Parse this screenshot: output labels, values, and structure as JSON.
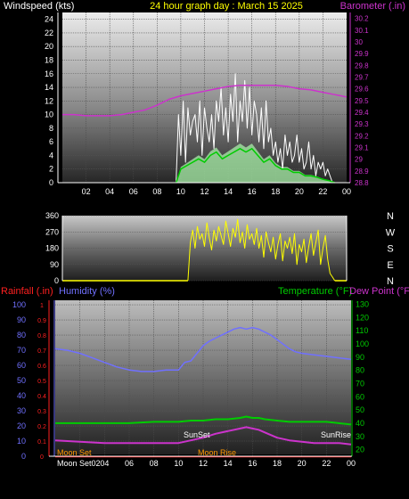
{
  "header": {
    "title": "24 hour graph day : March 15 2025",
    "left_axis_title": "Windspeed (kts)",
    "right_axis_title": "Barometer (.in)"
  },
  "colors": {
    "windspeed": "#ffffff",
    "wind_average": "#00cc00",
    "wind_band": "#a8f0a8",
    "barometer": "#cc33cc",
    "wind_direction": "#ffff00",
    "humidity": "#7070ff",
    "temperature": "#00cc00",
    "dew_point": "#cc33cc",
    "rainfall": "#ff2020",
    "title": "#ffff00",
    "moon": "#ff9900"
  },
  "chart_data": [
    {
      "type": "line",
      "panel": "wind",
      "x_ticks": [
        "02",
        "04",
        "06",
        "08",
        "10",
        "12",
        "14",
        "16",
        "18",
        "20",
        "22",
        "00"
      ],
      "left_ticks": [
        "0",
        "2",
        "4",
        "6",
        "8",
        "10",
        "12",
        "14",
        "16",
        "18",
        "20",
        "22",
        "24"
      ],
      "right_ticks": [
        "28.8",
        "28.9",
        "29",
        "29.1",
        "29.2",
        "29.3",
        "29.4",
        "29.5",
        "29.6",
        "29.7",
        "29.8",
        "29.9",
        "30",
        "30.1",
        "30.2"
      ],
      "ylim_left": [
        0,
        25
      ],
      "ylim_right": [
        28.8,
        30.25
      ],
      "xlim": [
        0,
        24
      ],
      "series": [
        {
          "name": "Windspeed",
          "axis": "left",
          "x": [
            9.6,
            9.8,
            10,
            10.2,
            10.4,
            10.6,
            10.8,
            11,
            11.2,
            11.4,
            11.6,
            11.8,
            12,
            12.2,
            12.4,
            12.6,
            12.8,
            13,
            13.2,
            13.4,
            13.6,
            13.8,
            14,
            14.2,
            14.4,
            14.6,
            14.8,
            15,
            15.2,
            15.4,
            15.6,
            15.8,
            16,
            16.2,
            16.4,
            16.6,
            16.8,
            17,
            17.2,
            17.4,
            17.6,
            17.8,
            18,
            18.2,
            18.4,
            18.6,
            18.8,
            19,
            19.2,
            19.4,
            19.6,
            19.8,
            20,
            20.2,
            20.4,
            20.6,
            20.8,
            21,
            21.2,
            21.4,
            21.6,
            21.8,
            22,
            22.2,
            22.4,
            22.6,
            22.8,
            23
          ],
          "values": [
            0,
            10,
            4,
            12,
            3,
            11,
            7,
            9,
            10,
            6,
            12,
            4,
            11,
            8,
            6,
            10,
            5,
            12,
            9,
            14,
            7,
            11,
            6,
            13,
            9,
            16,
            6,
            12,
            9,
            15,
            8,
            14,
            7,
            12,
            10,
            6,
            11,
            5,
            12,
            6,
            8,
            4,
            6,
            3,
            5,
            2,
            7,
            4,
            6,
            3,
            4,
            7,
            3,
            5,
            2,
            3,
            6,
            2,
            4,
            1,
            3,
            2,
            3,
            1,
            2,
            1,
            0,
            0
          ]
        },
        {
          "name": "Wind average",
          "axis": "left",
          "x": [
            9.6,
            10,
            10.5,
            11,
            11.5,
            12,
            12.5,
            13,
            13.5,
            14,
            14.5,
            15,
            15.5,
            16,
            16.5,
            17,
            17.5,
            18,
            18.5,
            19,
            19.5,
            20,
            20.5,
            21,
            21.5,
            22,
            22.5,
            23
          ],
          "values": [
            0,
            2,
            2.5,
            3,
            3.5,
            3,
            4,
            4.5,
            3.5,
            4,
            4.5,
            5,
            4.5,
            5,
            4,
            3,
            3.5,
            2.5,
            2,
            2,
            1.5,
            1.5,
            1,
            1,
            0.8,
            0.5,
            0.3,
            0
          ]
        },
        {
          "name": "Barometer",
          "axis": "right",
          "x": [
            0,
            1,
            2,
            3,
            4,
            5,
            6,
            7,
            8,
            9,
            10,
            11,
            12,
            13,
            14,
            15,
            16,
            17,
            18,
            19,
            20,
            21,
            22,
            23,
            24
          ],
          "values": [
            29.38,
            29.38,
            29.37,
            29.37,
            29.37,
            29.38,
            29.4,
            29.42,
            29.46,
            29.51,
            29.54,
            29.56,
            29.58,
            29.6,
            29.62,
            29.63,
            29.63,
            29.63,
            29.63,
            29.62,
            29.6,
            29.59,
            29.57,
            29.55,
            29.53
          ]
        }
      ]
    },
    {
      "type": "line",
      "panel": "direction",
      "left_ticks": [
        "0",
        "90",
        "180",
        "270",
        "360"
      ],
      "right_ticks": [
        "N",
        "E",
        "S",
        "W",
        "N"
      ],
      "ylim": [
        0,
        360
      ],
      "xlim": [
        0,
        24
      ],
      "series": [
        {
          "name": "Wind direction",
          "x": [
            10.6,
            10.8,
            11,
            11.2,
            11.4,
            11.6,
            11.8,
            12,
            12.2,
            12.4,
            12.6,
            12.8,
            13,
            13.2,
            13.4,
            13.6,
            13.8,
            14,
            14.2,
            14.4,
            14.6,
            14.8,
            15,
            15.2,
            15.4,
            15.6,
            15.8,
            16,
            16.2,
            16.4,
            16.6,
            16.8,
            17,
            17.2,
            17.4,
            17.6,
            17.8,
            18,
            18.2,
            18.4,
            18.6,
            18.8,
            19,
            19.2,
            19.4,
            19.6,
            19.8,
            20,
            20.2,
            20.4,
            20.6,
            20.8,
            21,
            21.2,
            21.4,
            21.6,
            21.8,
            22,
            22.2,
            22.4,
            22.6,
            22.8,
            23
          ],
          "values": [
            0,
            210,
            280,
            180,
            300,
            230,
            260,
            190,
            320,
            240,
            170,
            280,
            220,
            300,
            250,
            200,
            330,
            260,
            190,
            290,
            240,
            340,
            210,
            270,
            180,
            310,
            230,
            260,
            200,
            290,
            180,
            250,
            130,
            270,
            210,
            160,
            240,
            120,
            200,
            260,
            110,
            220,
            180,
            240,
            150,
            260,
            90,
            200,
            160,
            230,
            100,
            190,
            260,
            140,
            210,
            280,
            90,
            180,
            250,
            120,
            40,
            20,
            0
          ]
        }
      ]
    },
    {
      "type": "line",
      "panel": "climate",
      "x_ticks": [
        "02",
        "04",
        "06",
        "08",
        "10",
        "12",
        "14",
        "16",
        "18",
        "20",
        "22",
        "00"
      ],
      "rain_ticks": [
        "0",
        "0.1",
        "0.2",
        "0.3",
        "0.4",
        "0.5",
        "0.6",
        "0.7",
        "0.8",
        "0.9",
        "1"
      ],
      "humidity_ticks": [
        "0",
        "10",
        "20",
        "30",
        "40",
        "50",
        "60",
        "70",
        "80",
        "90",
        "100"
      ],
      "temp_ticks": [
        "20",
        "30",
        "40",
        "50",
        "60",
        "70",
        "80",
        "90",
        "100",
        "110",
        "120",
        "130"
      ],
      "ylim_humidity": [
        0,
        100
      ],
      "ylim_temp": [
        15,
        130
      ],
      "xlim": [
        0,
        24
      ],
      "labels": {
        "rainfall": "Rainfall (.in)",
        "humidity": "Humidity (%)",
        "temperature": "Temperature (°F)",
        "dew_point": "Dew Point (°F)"
      },
      "annotations": {
        "sunset": "SunSet",
        "sunrise": "SunRise",
        "moon_set": "Moon Set",
        "moon_set_axis": "Moon Set02",
        "moon_rise": "Moon Rise"
      },
      "series": [
        {
          "name": "Humidity",
          "x": [
            0,
            1,
            2,
            3,
            4,
            5,
            6,
            7,
            8,
            9,
            10,
            10.5,
            11,
            11.5,
            12,
            12.5,
            13,
            13.5,
            14,
            14.5,
            15,
            15.5,
            16,
            16.5,
            17,
            17.5,
            18,
            18.5,
            19,
            19.5,
            20,
            21,
            22,
            23,
            24
          ],
          "values": [
            71,
            70,
            68,
            65,
            62,
            59,
            57,
            56,
            56,
            57,
            57,
            62,
            63,
            68,
            73,
            76,
            78,
            80,
            82,
            84,
            85,
            84,
            85,
            84,
            82,
            80,
            77,
            74,
            71,
            69,
            68,
            67,
            66,
            65,
            64
          ]
        },
        {
          "name": "Temperature",
          "x": [
            0,
            2,
            4,
            6,
            8,
            10,
            11,
            12,
            13,
            14,
            15,
            15.5,
            16,
            16.5,
            17,
            18,
            19,
            20,
            21,
            22,
            23,
            24
          ],
          "values": [
            40,
            40,
            40,
            40,
            41,
            41,
            42,
            42,
            43,
            43,
            44,
            45,
            44,
            44,
            43,
            42,
            41,
            41,
            41,
            41,
            40,
            39
          ]
        },
        {
          "name": "Dew Point",
          "x": [
            0,
            2,
            4,
            6,
            8,
            10,
            11,
            12,
            13,
            14,
            15,
            15.5,
            16,
            16.5,
            17,
            18,
            19,
            20,
            21,
            22,
            23,
            24
          ],
          "values": [
            27,
            26,
            25,
            25,
            25,
            25,
            27,
            29,
            32,
            34,
            36,
            37,
            36,
            35,
            33,
            29,
            27,
            26,
            25,
            25,
            25,
            24
          ]
        },
        {
          "name": "Rainfall",
          "x": [
            0,
            24
          ],
          "values": [
            0,
            0
          ]
        }
      ]
    }
  ]
}
